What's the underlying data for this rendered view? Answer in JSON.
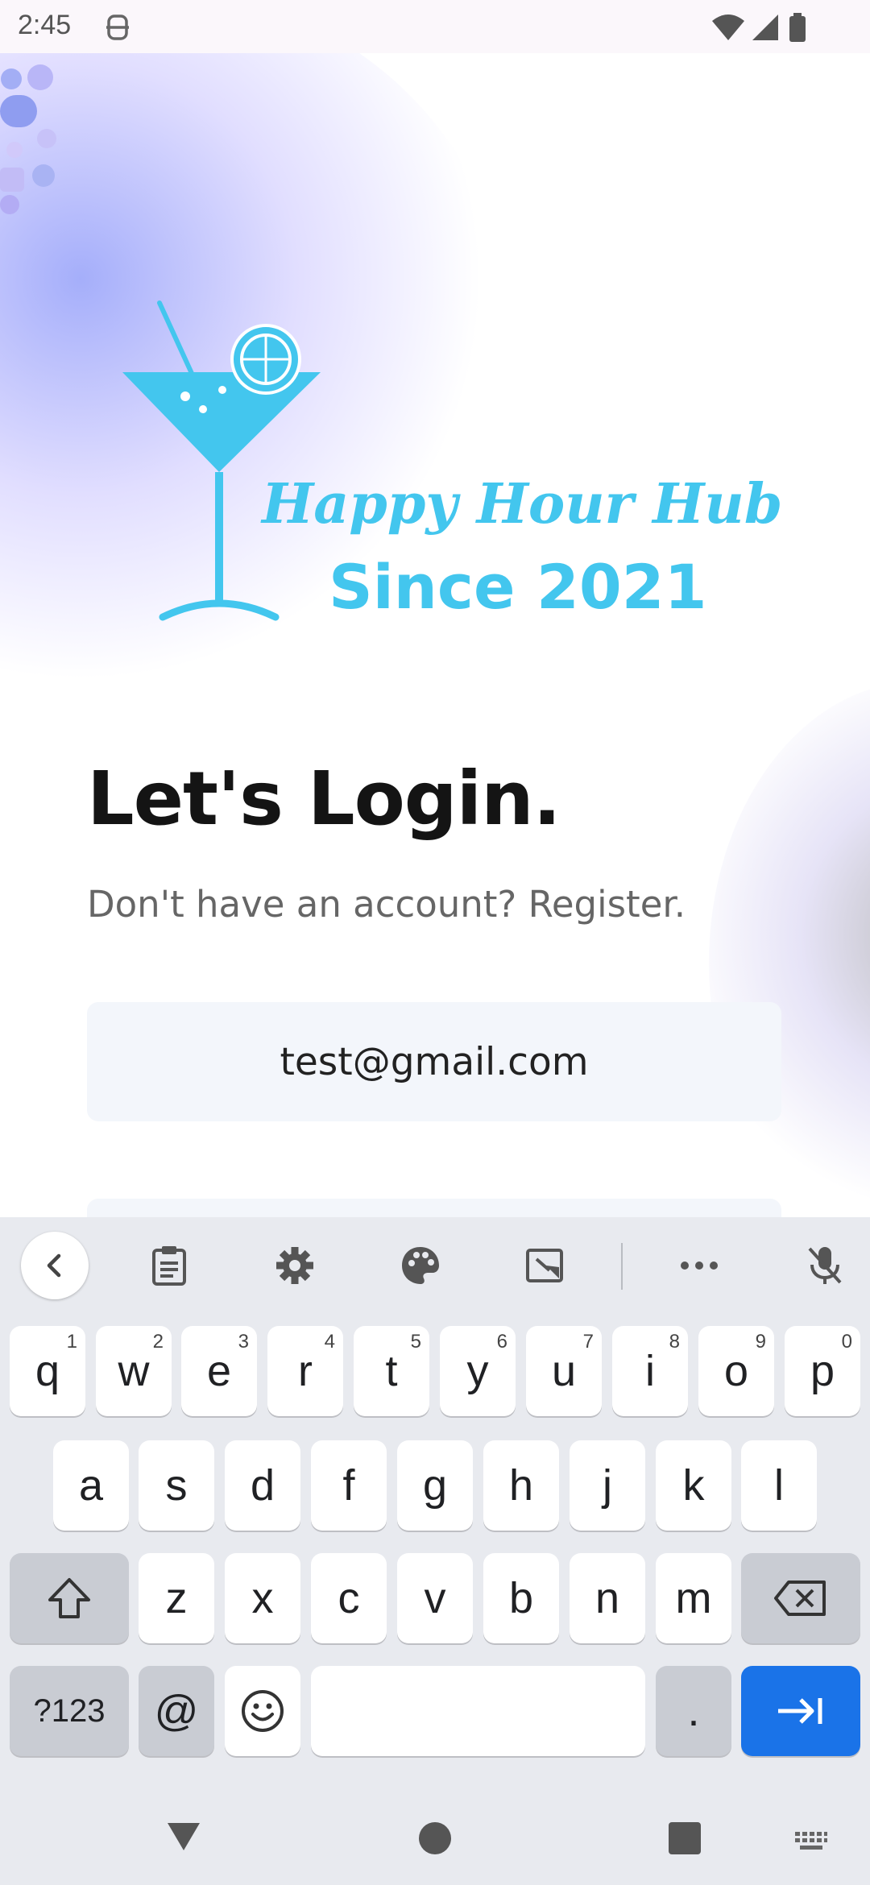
{
  "status_bar": {
    "time": "2:45"
  },
  "brand": {
    "name": "Happy Hour Hub",
    "tagline": "Since 2021"
  },
  "login": {
    "heading": "Let's Login.",
    "register_prompt": "Don't have an account? Register.",
    "email_value": "test@gmail.com"
  },
  "keyboard": {
    "row1": [
      {
        "k": "q",
        "h": "1"
      },
      {
        "k": "w",
        "h": "2"
      },
      {
        "k": "e",
        "h": "3"
      },
      {
        "k": "r",
        "h": "4"
      },
      {
        "k": "t",
        "h": "5"
      },
      {
        "k": "y",
        "h": "6"
      },
      {
        "k": "u",
        "h": "7"
      },
      {
        "k": "i",
        "h": "8"
      },
      {
        "k": "o",
        "h": "9"
      },
      {
        "k": "p",
        "h": "0"
      }
    ],
    "row2": [
      "a",
      "s",
      "d",
      "f",
      "g",
      "h",
      "j",
      "k",
      "l"
    ],
    "row3": [
      "z",
      "x",
      "c",
      "v",
      "b",
      "n",
      "m"
    ],
    "symbols_label": "?123",
    "at_label": "@",
    "period_label": "."
  },
  "colors": {
    "brand": "#43c6ee",
    "action": "#1a73e8"
  }
}
